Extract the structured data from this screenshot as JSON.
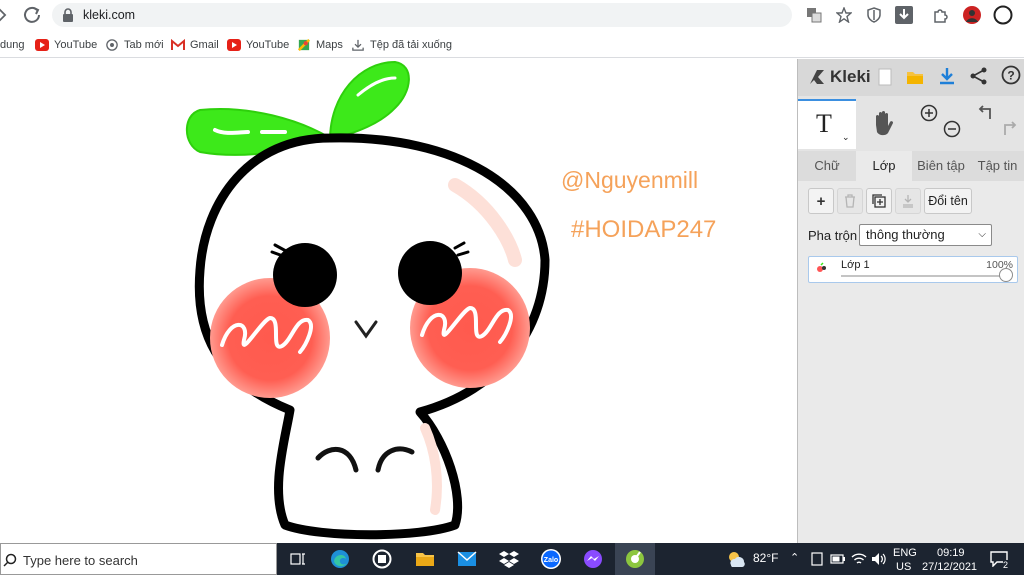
{
  "browser": {
    "url": "kleki.com",
    "bookmarks": [
      {
        "label": "dung",
        "icon": "none"
      },
      {
        "label": "YouTube",
        "icon": "youtube-icon"
      },
      {
        "label": "Tab mới",
        "icon": "chrome-icon"
      },
      {
        "label": "Gmail",
        "icon": "gmail-icon"
      },
      {
        "label": "YouTube",
        "icon": "youtube-icon"
      },
      {
        "label": "Maps",
        "icon": "maps-icon"
      },
      {
        "label": "Tệp đã tải xuống",
        "icon": "download-icon"
      }
    ]
  },
  "canvas": {
    "watermark_1": "@Nguyenmill",
    "watermark_2": "#HOIDAP247"
  },
  "panel": {
    "logo": "Kleki",
    "tool_selected": "T",
    "tabs": [
      {
        "label": "Chữ",
        "active": false
      },
      {
        "label": "Lớp",
        "active": true
      },
      {
        "label": "Biên tập",
        "active": false
      },
      {
        "label": "Tập tin",
        "active": false
      }
    ],
    "rename_label": "Đổi tên",
    "blend_label": "Pha trộn",
    "blend_value": "thông thường",
    "layers": [
      {
        "name": "Lớp 1",
        "opacity": "100%",
        "opacity_value": 1.0
      }
    ]
  },
  "taskbar": {
    "search_placeholder": "Type here to search",
    "weather": "82°F",
    "lang_1": "ENG",
    "lang_2": "US",
    "time": "09:19",
    "date": "27/12/2021",
    "notif_count": "2"
  },
  "colors": {
    "accent": "#3b8fe0",
    "watermark": "#f5a25a",
    "leaf": "#3de91a",
    "cheek": "#ff4d44"
  }
}
